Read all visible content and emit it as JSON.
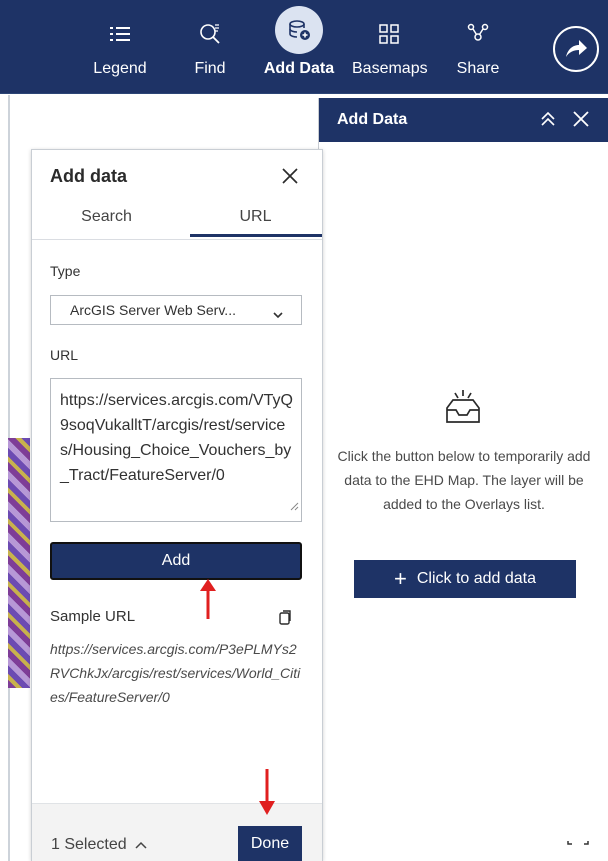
{
  "toolbar": {
    "items": [
      {
        "label": "Legend",
        "icon": "legend-icon"
      },
      {
        "label": "Find",
        "icon": "find-icon"
      },
      {
        "label": "Add Data",
        "icon": "add-data-icon",
        "active": true
      },
      {
        "label": "Basemaps",
        "icon": "basemaps-icon"
      },
      {
        "label": "Share",
        "icon": "share-icon"
      }
    ],
    "colors": {
      "bar": "#1e3366",
      "active_bg": "#dbe3f1"
    }
  },
  "right_panel": {
    "title": "Add Data",
    "empty_text": "Click the button below to temporarily add data to the EHD Map. The layer will be added to the Overlays list.",
    "add_button": "Click to add data"
  },
  "add_data_panel": {
    "title": "Add data",
    "tabs": [
      {
        "label": "Search",
        "selected": false
      },
      {
        "label": "URL",
        "selected": true
      }
    ],
    "type_label": "Type",
    "type_value": "ArcGIS Server Web Serv...",
    "url_label": "URL",
    "url_value": "https://services.arcgis.com/VTyQ9soqVukalltT/arcgis/rest/services/Housing_Choice_Vouchers_by_Tract/FeatureServer/0",
    "add_button": "Add",
    "sample_label": "Sample URL",
    "sample_url": "https://services.arcgis.com/P3ePLMYs2RVChkJx/arcgis/rest/services/World_Cities/FeatureServer/0",
    "selected_text": "1 Selected",
    "done_button": "Done"
  },
  "annotation_color": "#e01f1f"
}
